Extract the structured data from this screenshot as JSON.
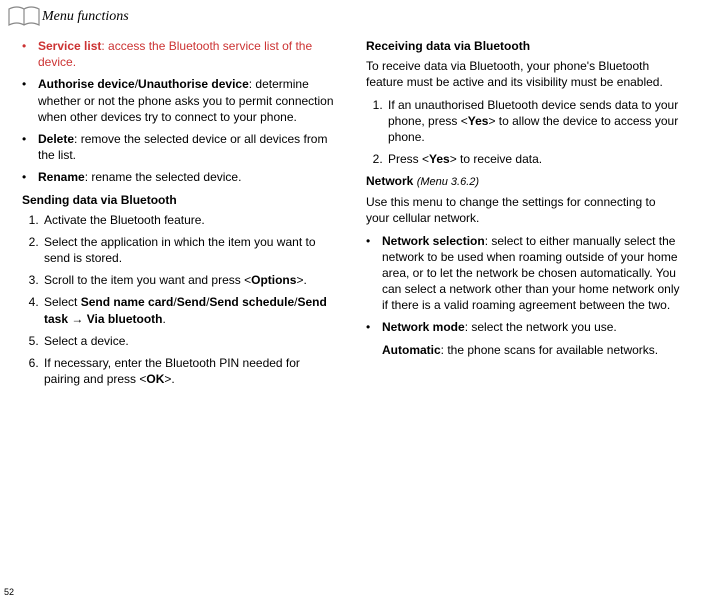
{
  "header": {
    "section": "Menu functions"
  },
  "pageNumber": "52",
  "left": {
    "b1": {
      "title": "Service list",
      "rest": ": access the Bluetooth service list of the device."
    },
    "b2": {
      "title": "Authorise device",
      "sep1": "/",
      "title2": "Unauthorise device",
      "rest": ": determine whether or not the phone asks you to permit connection when other devices try to connect to your phone."
    },
    "b3": {
      "title": "Delete",
      "rest": ": remove the selected device or all devices from the list."
    },
    "b4": {
      "title": "Rename",
      "rest": ": rename the selected device."
    },
    "sendHeading": "Sending data via Bluetooth",
    "s1": "Activate the Bluetooth feature.",
    "s2": "Select the application in which the item you want to send is stored.",
    "s3": {
      "pre": "Scroll to the item you want and press <",
      "opt": "Options",
      "post": ">."
    },
    "s4": {
      "pre": "Select ",
      "a": "Send name card",
      "sep": "/",
      "b": "Send",
      "sep2": "/",
      "c": "Send schedule",
      "sep3": "/",
      "d": "Send task",
      "arrow": " → ",
      "e": "Via bluetooth",
      "post": "."
    },
    "s5": "Select a device.",
    "s6": {
      "pre": "If necessary, enter the Bluetooth PIN needed for pairing and press <",
      "ok": "OK",
      "post": ">."
    }
  },
  "right": {
    "recvHeading": "Receiving data via Bluetooth",
    "recvBody": "To receive data via Bluetooth, your phone's Bluetooth feature must be active and its visibility must be enabled.",
    "r1": {
      "pre": "If an unauthorised Bluetooth device sends data to your phone, press <",
      "yes": "Yes",
      "post": "> to allow the device to access your phone."
    },
    "r2": {
      "pre": "Press <",
      "yes": "Yes",
      "post": "> to receive data."
    },
    "netHeading": "Network",
    "netMenu": "(Menu 3.6.2)",
    "netBody": "Use this menu to change the settings for connecting to your cellular network.",
    "nb1": {
      "title": "Network selection",
      "rest": ": select to either manually select the network to be used when roaming outside of your home area, or to let the network be chosen automatically. You can select a network other than your home network only if there is a valid roaming agreement between the two."
    },
    "nb2": {
      "title": "Network mode",
      "rest": ": select the network you use."
    },
    "nb2sub": {
      "title": "Automatic",
      "rest": ": the phone scans for available networks."
    }
  }
}
